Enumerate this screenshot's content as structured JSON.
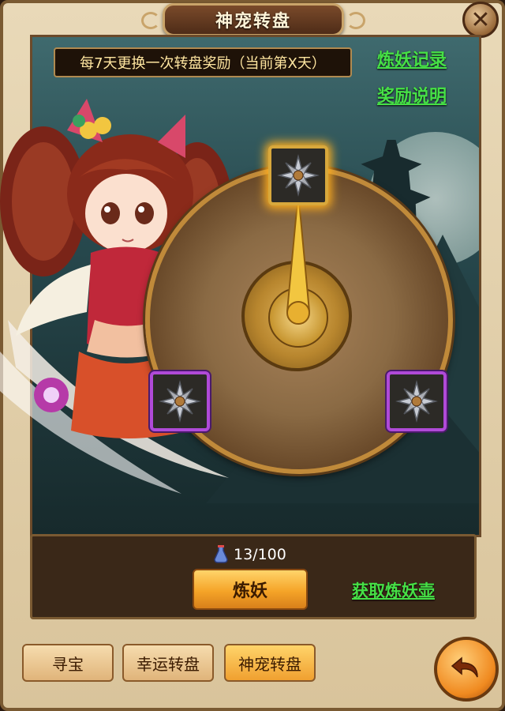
{
  "window": {
    "title": "神宠转盘",
    "close_label": "✕"
  },
  "notice": {
    "text": "每7天更换一次转盘奖励（当前第X天）"
  },
  "links": {
    "records": "炼妖记录",
    "rules": "奖励说明",
    "get_pot": "获取炼妖壶"
  },
  "wheel": {
    "prizes": [
      "shuriken-icon",
      "shuriken-icon",
      "shuriken-icon"
    ],
    "selected_index": 0,
    "pointer": "golden-needle"
  },
  "resource": {
    "icon": "potion-icon",
    "count": "13/100"
  },
  "actions": {
    "refine_label": "炼妖"
  },
  "tabs": [
    {
      "label": "寻宝",
      "active": false
    },
    {
      "label": "幸运转盘",
      "active": false
    },
    {
      "label": "神宠转盘",
      "active": true
    }
  ],
  "colors": {
    "link_green": "#46e046",
    "gold": "#d8a83c",
    "purple_frame": "#b04ad8",
    "button_orange": "#f5a428"
  }
}
